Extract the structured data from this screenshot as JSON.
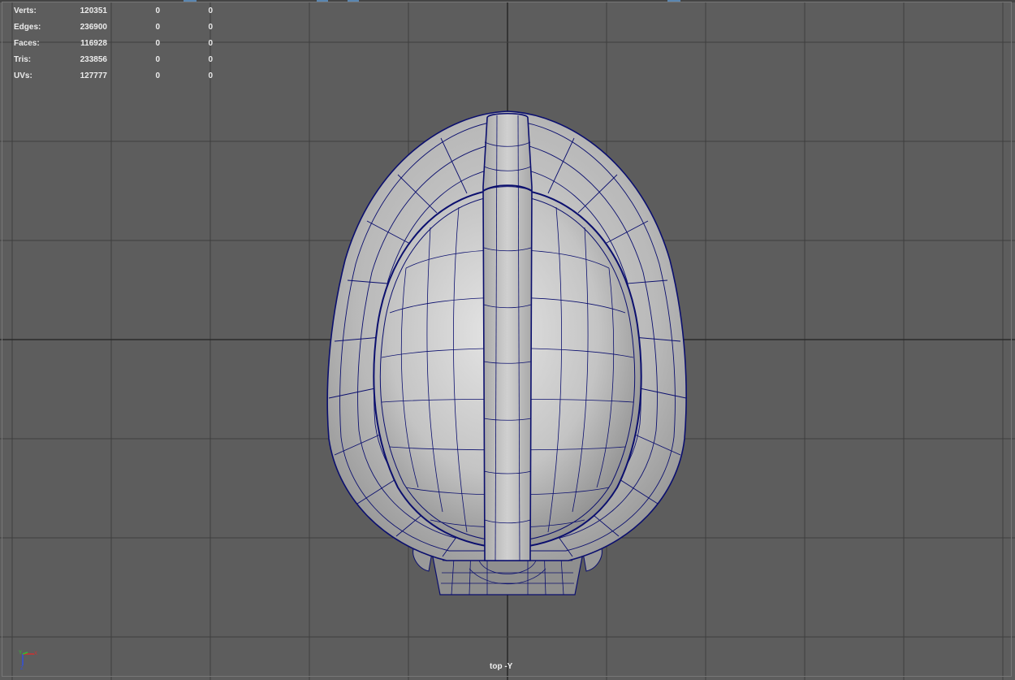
{
  "viewport": {
    "camera_label": "top -Y",
    "background_color": "#5d5d5d",
    "grid_color": "#3e3e3e",
    "axis_line_color": "#2b2b2b",
    "wireframe_color": "#0b0f6e"
  },
  "heads_up_display": {
    "rows": [
      {
        "label": "Verts:",
        "total": "120351",
        "selected": "0",
        "extra": "0"
      },
      {
        "label": "Edges:",
        "total": "236900",
        "selected": "0",
        "extra": "0"
      },
      {
        "label": "Faces:",
        "total": "116928",
        "selected": "0",
        "extra": "0"
      },
      {
        "label": "Tris:",
        "total": "233856",
        "selected": "0",
        "extra": "0"
      },
      {
        "label": "UVs:",
        "total": "127777",
        "selected": "0",
        "extra": "0"
      }
    ]
  },
  "axis_gizmo": {
    "icon": "axis-gizmo-icon",
    "x_color": "#d03030",
    "y_color": "#30c030",
    "z_color": "#3050e0"
  }
}
